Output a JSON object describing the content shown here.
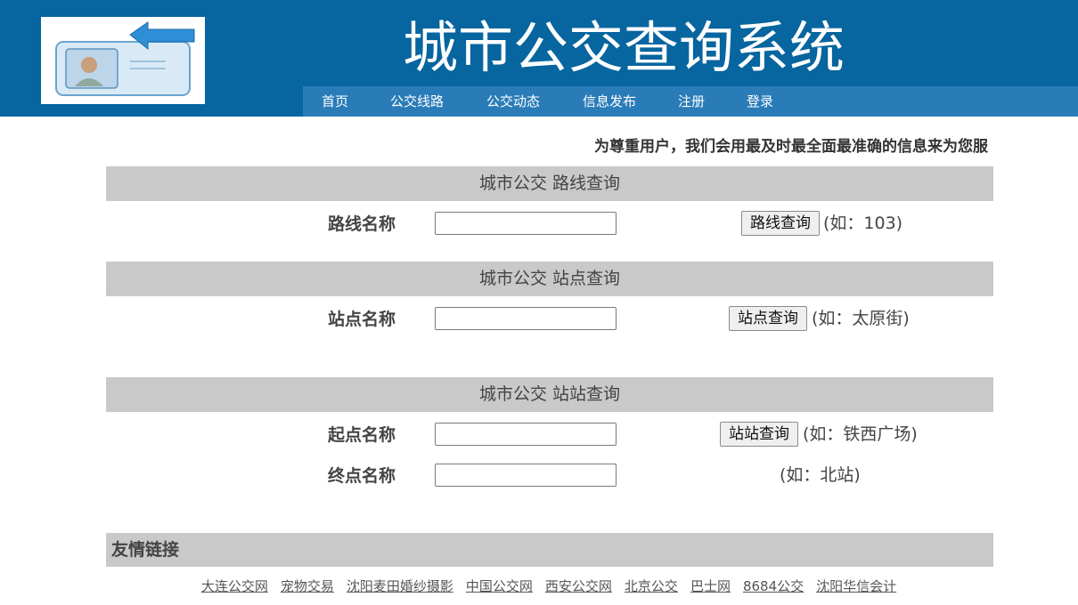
{
  "header": {
    "title": "城市公交查询系统",
    "nav": [
      "首页",
      "公交线路",
      "公交动态",
      "信息发布",
      "注册",
      "登录"
    ]
  },
  "tagline": "为尊重用户，我们会用最及时最全面最准确的信息来为您服",
  "route_query": {
    "title": "城市公交 路线查询",
    "label": "路线名称",
    "button": "路线查询",
    "hint": "(如：103)"
  },
  "stop_query": {
    "title": "城市公交 站点查询",
    "label": "站点名称",
    "button": "站点查询",
    "hint": "(如：太原街)"
  },
  "station_query": {
    "title": "城市公交 站站查询",
    "start_label": "起点名称",
    "end_label": "终点名称",
    "button": "站站查询",
    "start_hint": "(如：铁西广场)",
    "end_hint": "(如：北站)"
  },
  "friend_links": {
    "title": "友情链接",
    "items": [
      "大连公交网",
      "宠物交易",
      "沈阳麦田婚纱摄影",
      "中国公交网",
      "西安公交网",
      "北京公交",
      "巴士网",
      "8684公交",
      "沈阳华信会计"
    ]
  },
  "colors": {
    "header_bg": "#07659f",
    "nav_bg": "#2a7cb8",
    "section_bg": "#c9c9c9"
  },
  "icons": {
    "logo": "contact-card-back-arrow-icon"
  }
}
